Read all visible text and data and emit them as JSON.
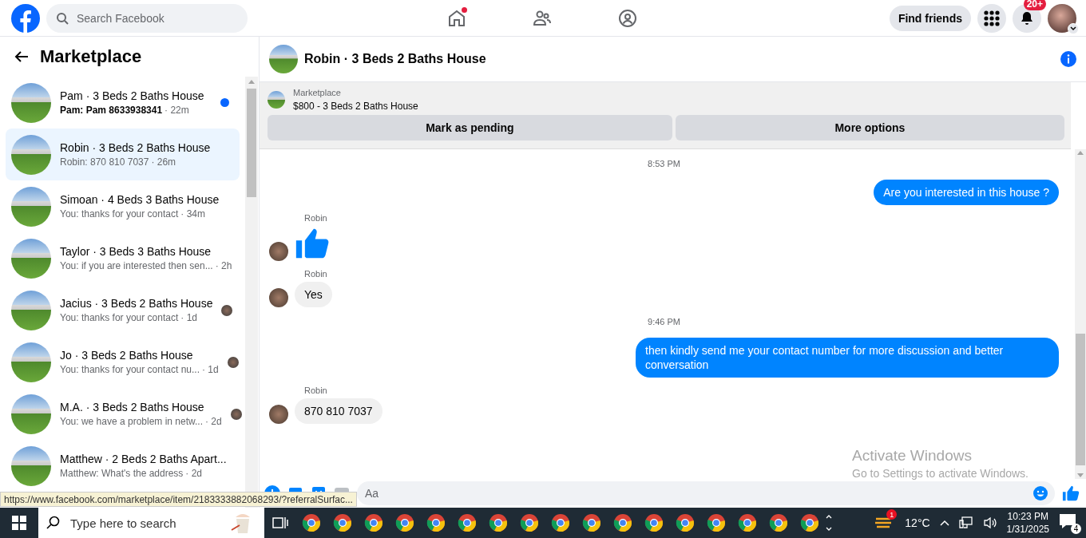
{
  "topbar": {
    "search": {
      "placeholder": "Search Facebook"
    },
    "nav": [
      {
        "kind": "home",
        "selected": false,
        "dot": true
      },
      {
        "kind": "friends",
        "selected": false,
        "dot": false
      },
      {
        "kind": "groups",
        "selected": false,
        "dot": false
      }
    ],
    "find_friends": "Find friends",
    "notification_count": "20+"
  },
  "sidebar": {
    "title": "Marketplace",
    "conversations": [
      {
        "title": "Pam · 3 Beds 2 Baths House",
        "preview": "Pam: Pam 8633938341",
        "time": "· 22m",
        "unread": true,
        "selected": false,
        "seen": false
      },
      {
        "title": "Robin · 3 Beds 2 Baths House",
        "preview": "Robin: 870 810 7037",
        "time": "· 26m",
        "unread": false,
        "selected": true,
        "seen": false
      },
      {
        "title": "Simoan · 4 Beds 3 Baths House",
        "preview": "You: thanks for your contact",
        "time": "· 34m",
        "unread": false,
        "selected": false,
        "seen": false
      },
      {
        "title": "Taylor · 3 Beds 3 Baths House",
        "preview": "You: if you are interested then sen...",
        "time": "· 2h",
        "unread": false,
        "selected": false,
        "seen": false
      },
      {
        "title": "Jacius · 3 Beds 2 Baths House",
        "preview": "You: thanks for your contact",
        "time": "· 1d",
        "unread": false,
        "selected": false,
        "seen": true
      },
      {
        "title": "Jo · 3 Beds 2 Baths House",
        "preview": "You: thanks for your contact nu...",
        "time": "· 1d",
        "unread": false,
        "selected": false,
        "seen": true
      },
      {
        "title": "M.A. · 3 Beds 2 Baths House",
        "preview": "You: we have a problem in netw...",
        "time": "· 2d",
        "unread": false,
        "selected": false,
        "seen": true
      },
      {
        "title": "Matthew · 2 Beds 2 Baths Apart...",
        "preview": "Matthew: What's the address",
        "time": "· 2d",
        "unread": false,
        "selected": false,
        "seen": false
      }
    ]
  },
  "chat": {
    "title": "Robin · 3 Beds 2 Baths House",
    "listing": {
      "label": "Marketplace",
      "name": "$800 - 3 Beds 2 Baths House"
    },
    "actions": [
      "Mark as pending",
      "More options"
    ],
    "messages": [
      {
        "kind": "time",
        "text": "8:53 PM"
      },
      {
        "kind": "sent",
        "text": "Are you interested in this house ?"
      },
      {
        "kind": "like",
        "sender": "Robin"
      },
      {
        "kind": "received",
        "sender": "Robin",
        "text": "Yes"
      },
      {
        "kind": "time",
        "text": "9:46 PM"
      },
      {
        "kind": "sent",
        "text": "then kindly send me your contact number for more discussion and better conversation"
      },
      {
        "kind": "received",
        "sender": "Robin",
        "text": "870 810 7037"
      }
    ],
    "composer": {
      "placeholder": "Aa"
    }
  },
  "status_url": "https://www.facebook.com/marketplace/item/2183333882068293/?referralSurfac...",
  "activation": {
    "title": "Activate Windows",
    "text": "Go to Settings to activate Windows."
  },
  "taskbar": {
    "search": {
      "placeholder": "Type here to search"
    },
    "weather_badge": "1",
    "temperature": "12°C",
    "time": "10:23 PM",
    "date": "1/31/2025",
    "notifications": "4"
  }
}
